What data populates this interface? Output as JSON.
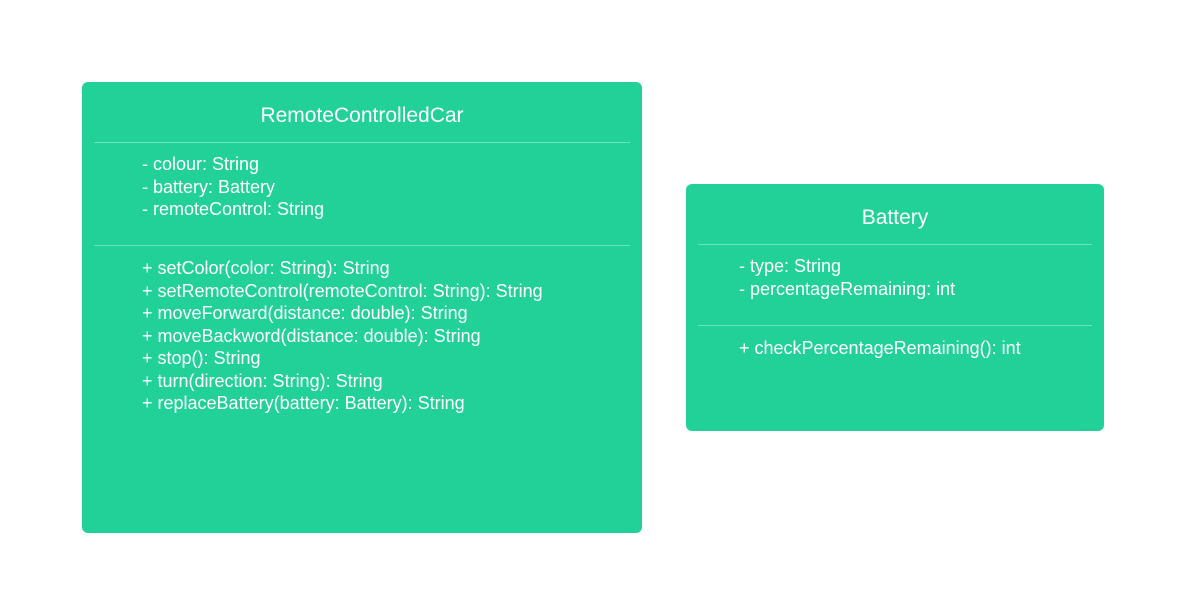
{
  "classes": [
    {
      "name": "RemoteControlledCar",
      "attributes": [
        "- colour: String",
        "- battery: Battery",
        "- remoteControl: String"
      ],
      "operations": [
        "+ setColor(color: String): String",
        "+ setRemoteControl(remoteControl: String): String",
        "+ moveForward(distance: double): String",
        "+ moveBackword(distance: double): String",
        "+ stop(): String",
        "+ turn(direction: String): String",
        "+ replaceBattery(battery: Battery): String"
      ]
    },
    {
      "name": "Battery",
      "attributes": [
        "- type: String",
        "- percentageRemaining: int"
      ],
      "operations": [
        "+ checkPercentageRemaining(): int"
      ]
    }
  ],
  "colors": {
    "class_fill": "#22d197",
    "text": "#ffffff",
    "background": "#ffffff"
  }
}
